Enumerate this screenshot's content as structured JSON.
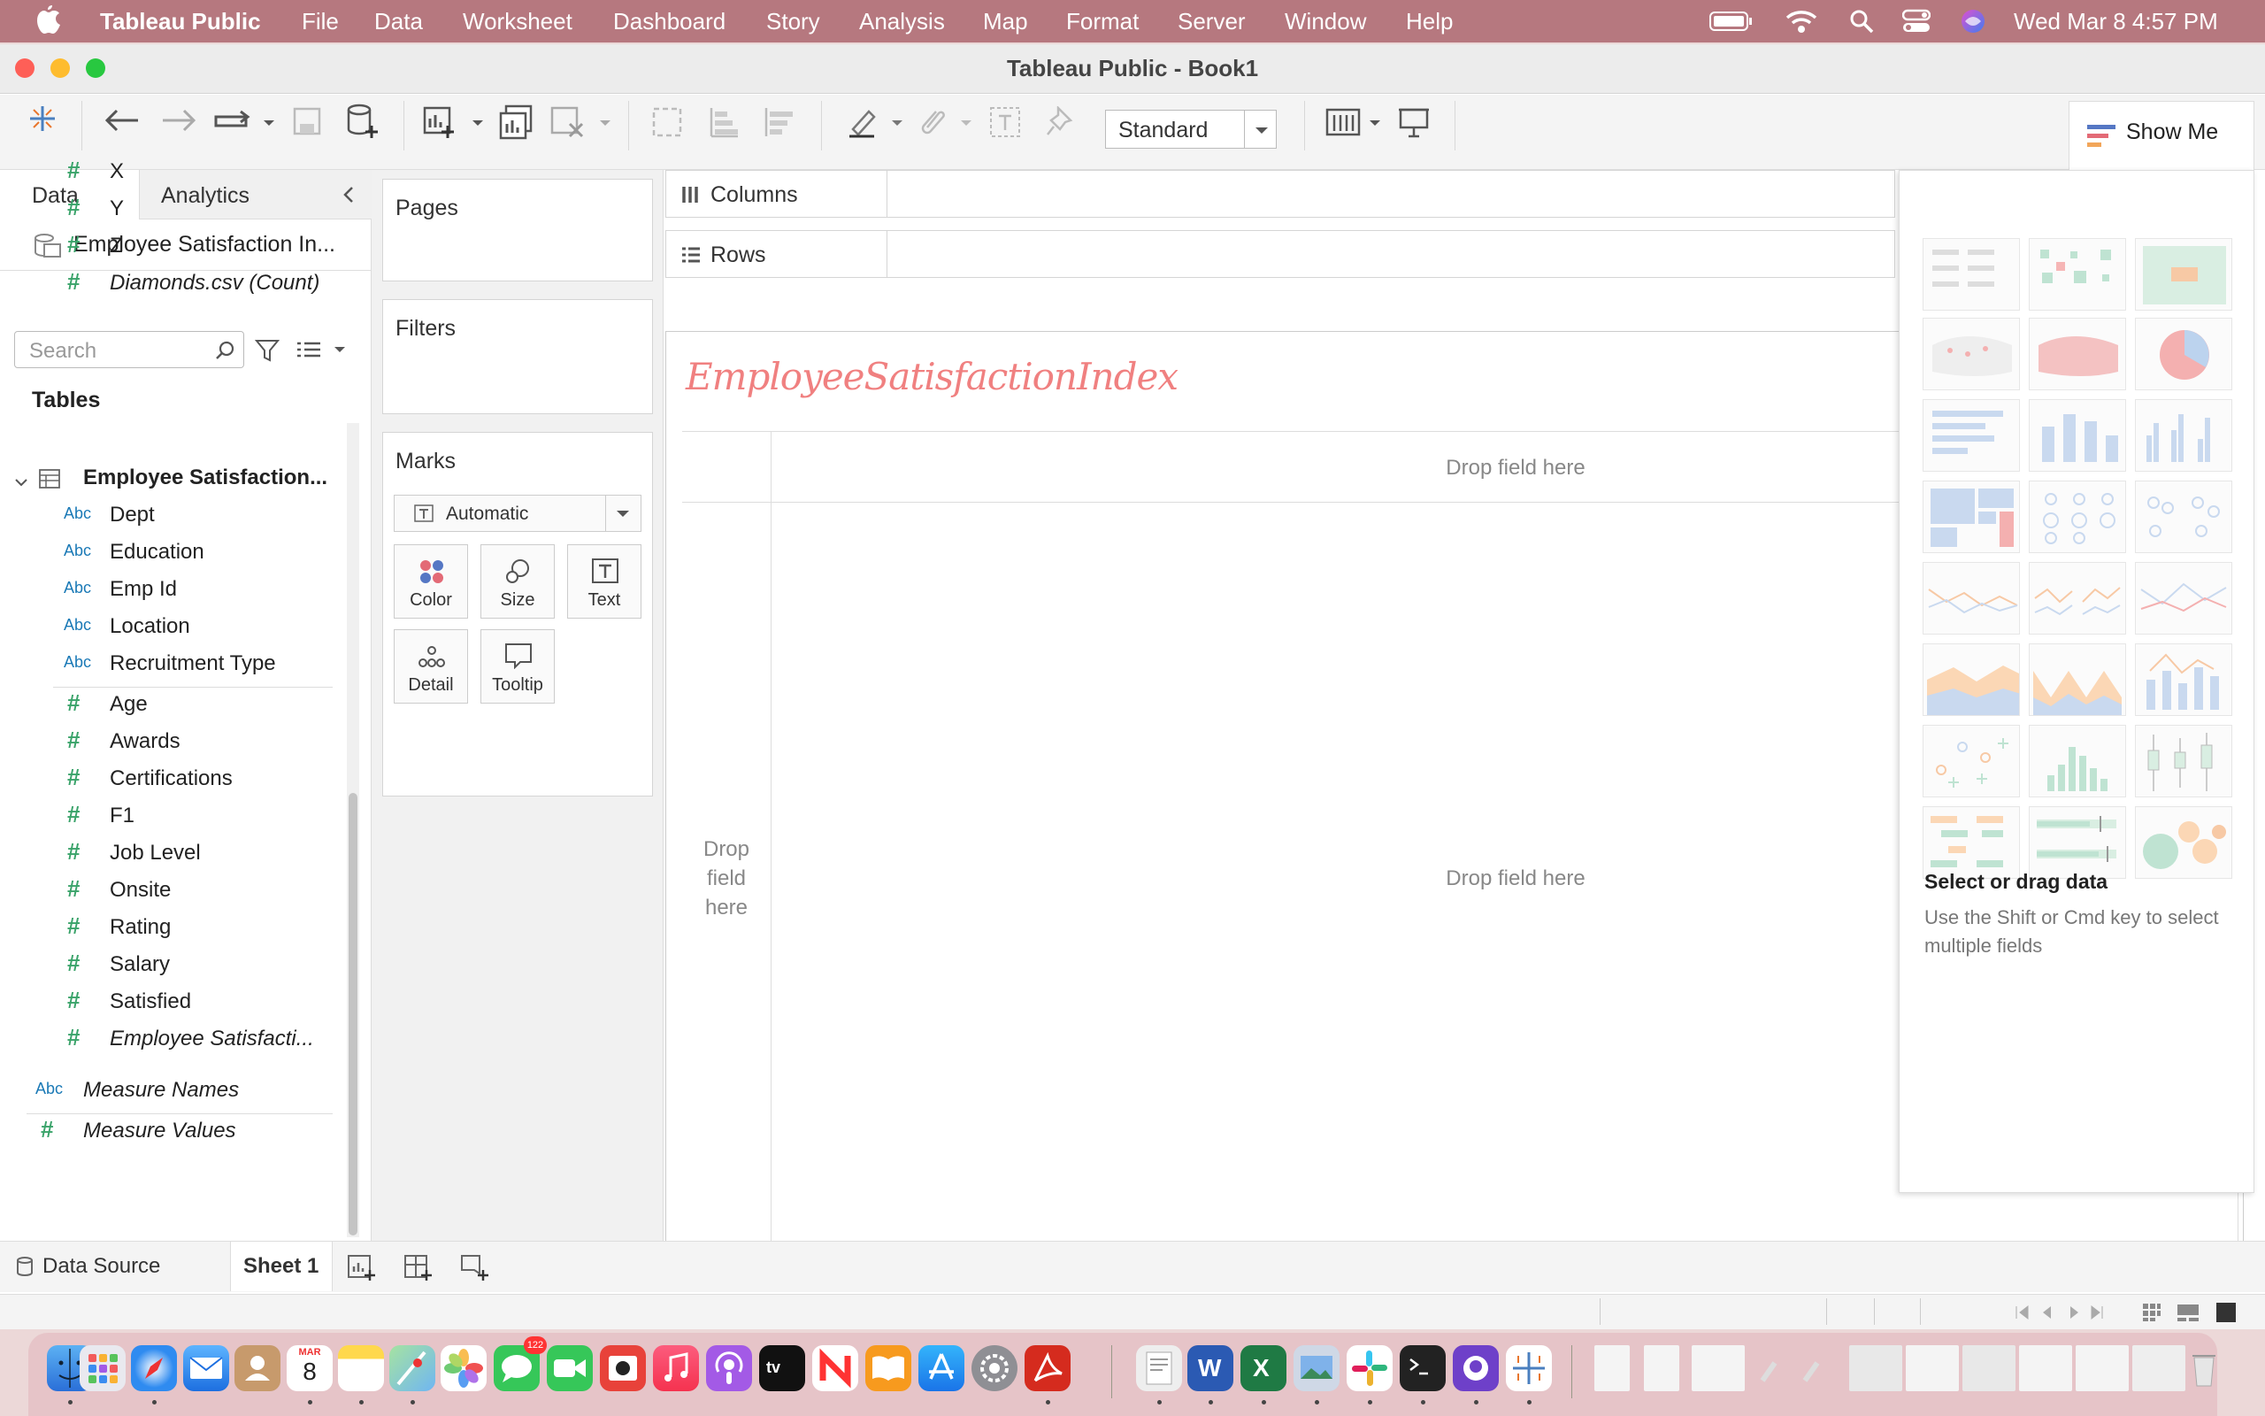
{
  "menubar": {
    "app": "Tableau Public",
    "items": [
      "File",
      "Data",
      "Worksheet",
      "Dashboard",
      "Story",
      "Analysis",
      "Map",
      "Format",
      "Server",
      "Window",
      "Help"
    ],
    "datetime": "Wed Mar 8  4:57 PM"
  },
  "window": {
    "title": "Tableau Public - Book1"
  },
  "toolbar": {
    "view_select": "Standard",
    "show_me": "Show Me"
  },
  "left": {
    "tab_data": "Data",
    "tab_analytics": "Analytics",
    "datasource": "Employee Satisfaction In...",
    "search_placeholder": "Search",
    "tables_label": "Tables",
    "diamonds_fields": [
      {
        "name": "X",
        "type": "#",
        "italic": false
      },
      {
        "name": "Y",
        "type": "#",
        "italic": false
      },
      {
        "name": "Z",
        "type": "#",
        "italic": false
      },
      {
        "name": "Diamonds.csv (Count)",
        "type": "#",
        "italic": true
      }
    ],
    "table_name": "Employee Satisfaction...",
    "dims": [
      {
        "name": "Dept",
        "type": "Abc"
      },
      {
        "name": "Education",
        "type": "Abc"
      },
      {
        "name": "Emp Id",
        "type": "Abc"
      },
      {
        "name": "Location",
        "type": "Abc"
      },
      {
        "name": "Recruitment Type",
        "type": "Abc"
      }
    ],
    "measures": [
      {
        "name": "Age",
        "italic": false
      },
      {
        "name": "Awards",
        "italic": false
      },
      {
        "name": "Certifications",
        "italic": false
      },
      {
        "name": "F1",
        "italic": false
      },
      {
        "name": "Job Level",
        "italic": false
      },
      {
        "name": "Onsite",
        "italic": false
      },
      {
        "name": "Rating",
        "italic": false
      },
      {
        "name": "Salary",
        "italic": false
      },
      {
        "name": "Satisfied",
        "italic": false
      },
      {
        "name": "Employee Satisfacti...",
        "italic": true
      }
    ],
    "measure_names": "Measure Names",
    "measure_values": "Measure Values",
    "type_abc": "Abc",
    "type_num": "#"
  },
  "cards": {
    "pages": "Pages",
    "filters": "Filters",
    "marks": "Marks",
    "marks_type": "Automatic",
    "buttons": [
      "Color",
      "Size",
      "Text",
      "Detail",
      "Tooltip"
    ]
  },
  "shelves": {
    "columns": "Columns",
    "rows": "Rows"
  },
  "canvas": {
    "title": "EmployeeSatisfactionIndex",
    "drop_top": "Drop field here",
    "drop_center": "Drop field here",
    "drop_left": "Drop\nfield\nhere"
  },
  "showme": {
    "heading": "Select or drag data",
    "hint": "Use the Shift or Cmd key to select multiple fields"
  },
  "bottom": {
    "datasource_tab": "Data Source",
    "sheet_tab": "Sheet 1"
  },
  "colors": {
    "menubar": "#b6787f",
    "title_text": "#f08080",
    "measure_green": "#3aa36a",
    "dim_blue": "#1a79b6"
  },
  "dock": {
    "calendar_day": "8",
    "calendar_month": "MAR",
    "messages_badge": "122"
  }
}
